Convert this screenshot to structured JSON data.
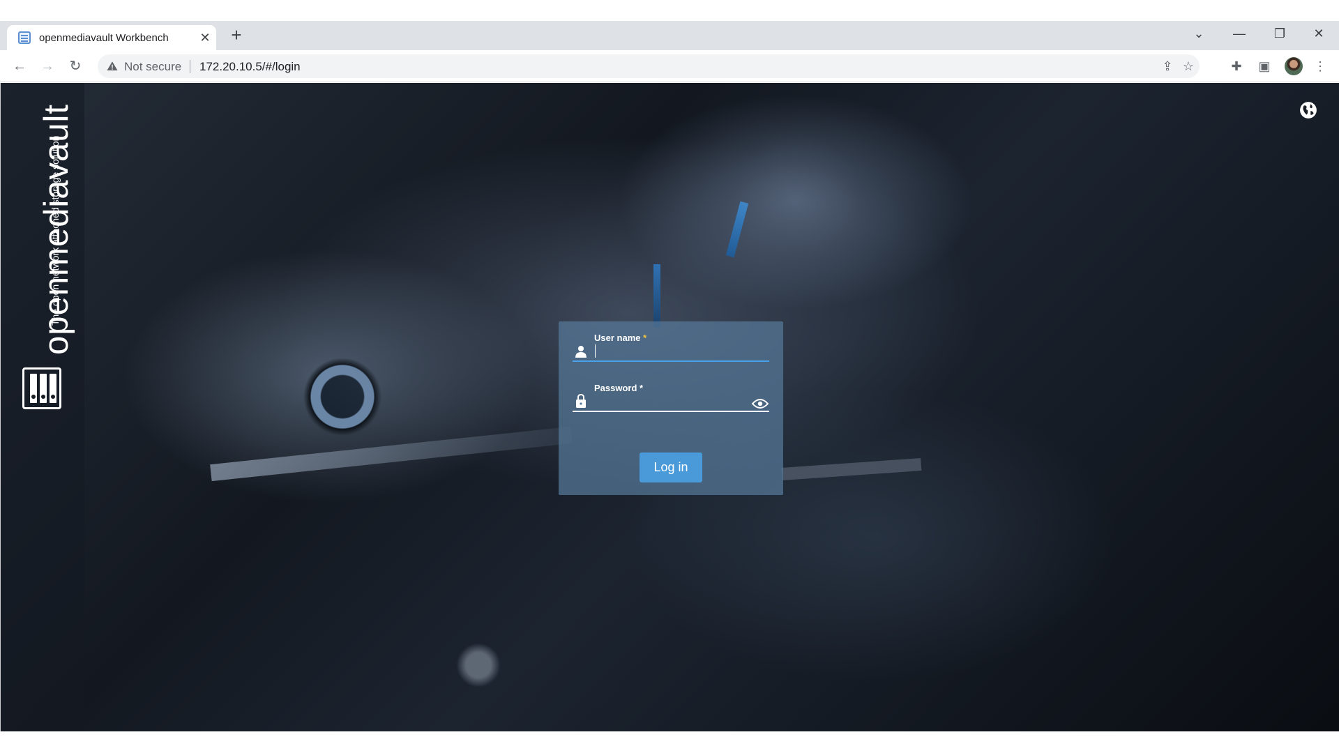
{
  "browser": {
    "tab_title": "openmediavault Workbench",
    "tab_close": "✕",
    "new_tab": "+",
    "security_label": "Not secure",
    "url": "172.20.10.5/#/login",
    "controls": {
      "tab_search": "⌄",
      "minimize": "—",
      "restore": "❐",
      "close": "✕"
    },
    "nav": {
      "back": "←",
      "forward": "→",
      "reload": "↻"
    },
    "toolbar_icons": {
      "share": "⇪",
      "bookmark": "☆",
      "extensions": "✚",
      "side_panel": "▣",
      "menu": "⋮"
    }
  },
  "brand": {
    "name": "openmediavault",
    "tagline": "The open network attached storage solution"
  },
  "login": {
    "username_label": "User name",
    "password_label": "Password",
    "required_mark": "*",
    "username_value": "",
    "password_value": "",
    "submit_label": "Log in"
  },
  "colors": {
    "accent": "#4a9ad9",
    "card_bg": "#56789880",
    "required_yellow": "#f5c542",
    "tab_strip": "#dee1e6"
  },
  "icons": {
    "username": "user-icon",
    "password": "lock-icon",
    "reveal": "eye-icon",
    "language": "globe-icon",
    "security": "warning-icon"
  }
}
